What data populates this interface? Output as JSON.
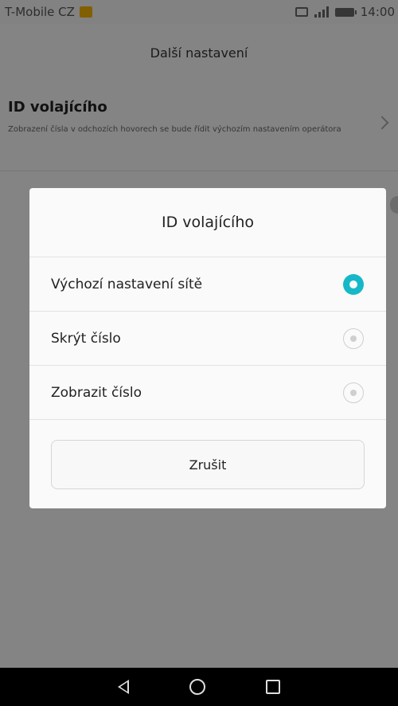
{
  "status_bar": {
    "carrier": "T-Mobile CZ",
    "time": "14:00"
  },
  "screen": {
    "title": "Další nastavení",
    "setting": {
      "title": "ID volajícího",
      "subtitle": "Zobrazení čísla v odchozích hovorech se bude řídit výchozím nastavením operátora"
    }
  },
  "dialog": {
    "title": "ID volajícího",
    "options": [
      {
        "label": "Výchozí nastavení sítě",
        "selected": true
      },
      {
        "label": "Skrýt číslo",
        "selected": false
      },
      {
        "label": "Zobrazit číslo",
        "selected": false
      }
    ],
    "cancel_label": "Zrušit"
  },
  "colors": {
    "accent": "#16b8c8"
  },
  "icons": {
    "notification": "notification-icon",
    "sim": "sim-icon",
    "signal": "signal-icon",
    "battery": "battery-icon",
    "back": "back-icon",
    "home": "home-icon",
    "recent": "recent-apps-icon"
  }
}
